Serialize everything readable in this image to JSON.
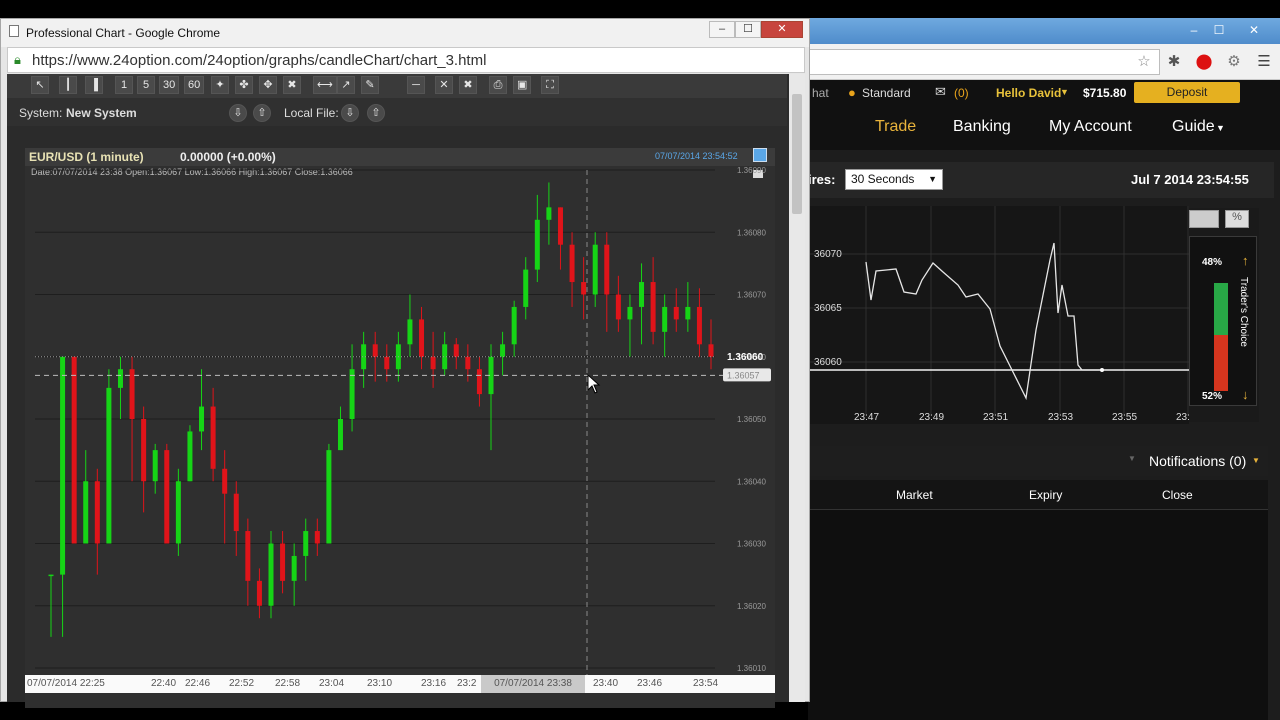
{
  "back_window": {
    "topbar": {
      "chat_partial": "hat",
      "account_type": "Standard",
      "messages": "(0)",
      "greeting": "Hello David",
      "balance": "$715.80",
      "deposit_label": "Deposit"
    },
    "nav": [
      "Trade",
      "Banking",
      "My Account",
      "Guide"
    ],
    "expires_label": "ires:",
    "expiry_select": "30 Seconds",
    "datetime": "Jul 7 2014  23:54:55",
    "mini_chart": {
      "y_ticks": [
        "36070",
        "36065",
        "36060"
      ],
      "x_ticks": [
        "23:47",
        "23:49",
        "23:51",
        "23:53",
        "23:55",
        "23:5"
      ],
      "points": [
        [
          866,
          262
        ],
        [
          871,
          300
        ],
        [
          876,
          271
        ],
        [
          896,
          269
        ],
        [
          904,
          292
        ],
        [
          916,
          294
        ],
        [
          922,
          280
        ],
        [
          933,
          263
        ],
        [
          943,
          272
        ],
        [
          958,
          285
        ],
        [
          966,
          297
        ],
        [
          978,
          294
        ],
        [
          990,
          309
        ],
        [
          1000,
          346
        ],
        [
          1012,
          370
        ],
        [
          1026,
          398
        ],
        [
          1036,
          330
        ],
        [
          1044,
          290
        ],
        [
          1050,
          260
        ],
        [
          1054,
          243
        ],
        [
          1058,
          313
        ],
        [
          1062,
          285
        ],
        [
          1068,
          316
        ],
        [
          1074,
          316
        ],
        [
          1078,
          365
        ],
        [
          1082,
          370
        ],
        [
          1102,
          370
        ]
      ]
    },
    "traders_choice": {
      "label": "Trader's Choice",
      "up_pct": "48%",
      "down_pct": "52%",
      "up": 0.48
    },
    "notifications": "Notifications (0)",
    "columns": [
      "Market",
      "Expiry",
      "Close"
    ]
  },
  "front_window": {
    "title": "Professional Chart - Google Chrome",
    "url": "https://www.24option.com/24option/graphs/candleChart/chart_3.html",
    "tools": [
      "1",
      "5",
      "30",
      "60"
    ],
    "system_label": "System:",
    "system_value": "New System",
    "local_file": "Local File:",
    "chart": {
      "pair": "EUR/USD (1 minute)",
      "change": "0.00000 (+0.00%)",
      "timestamp": "07/07/2014 23:54:52",
      "ohlc": "Date:07/07/2014 23:38 Open:1.36067 Low:1.36066 High:1.36067 Close:1.36066",
      "price_label": "1.36060",
      "cursor_price": "1.36057",
      "y_ticks": [
        "1.36090",
        "1.36080",
        "1.36070",
        "1.36060",
        "1.36050",
        "1.36040",
        "1.36030",
        "1.36020",
        "1.36010"
      ],
      "x_ticks": [
        "07/07/2014 22:25",
        "22:40",
        "22:46",
        "22:52",
        "22:58",
        "23:04",
        "23:10",
        "23:16",
        "23:2",
        "23:40",
        "23:46",
        "23:54"
      ],
      "crosshair_time": "07/07/2014 23:38"
    }
  },
  "chart_data": {
    "type": "candlestick",
    "ylim": [
      1.3601,
      1.3609
    ],
    "candles": [
      [
        1.36025,
        1.36025,
        1.36015,
        1.36025
      ],
      [
        1.36025,
        1.3606,
        1.36015,
        1.3606
      ],
      [
        1.3606,
        1.3603,
        1.3603,
        1.3606
      ],
      [
        1.3603,
        1.3604,
        1.3603,
        1.36045
      ],
      [
        1.3604,
        1.3603,
        1.36025,
        1.36042
      ],
      [
        1.3603,
        1.36055,
        1.3603,
        1.36058
      ],
      [
        1.36055,
        1.36058,
        1.3605,
        1.3606
      ],
      [
        1.36058,
        1.3605,
        1.3604,
        1.3606
      ],
      [
        1.3605,
        1.3604,
        1.36035,
        1.36052
      ],
      [
        1.3604,
        1.36045,
        1.36038,
        1.36046
      ],
      [
        1.36045,
        1.3603,
        1.3603,
        1.36046
      ],
      [
        1.3603,
        1.3604,
        1.36028,
        1.36042
      ],
      [
        1.3604,
        1.36048,
        1.3604,
        1.36049
      ],
      [
        1.36048,
        1.36052,
        1.36045,
        1.36058
      ],
      [
        1.36052,
        1.36042,
        1.3604,
        1.36055
      ],
      [
        1.36042,
        1.36038,
        1.3603,
        1.36045
      ],
      [
        1.36038,
        1.36032,
        1.36028,
        1.3604
      ],
      [
        1.36032,
        1.36024,
        1.3602,
        1.36034
      ],
      [
        1.36024,
        1.3602,
        1.36018,
        1.36026
      ],
      [
        1.3602,
        1.3603,
        1.36018,
        1.36032
      ],
      [
        1.3603,
        1.36024,
        1.36022,
        1.36032
      ],
      [
        1.36024,
        1.36028,
        1.3602,
        1.3603
      ],
      [
        1.36028,
        1.36032,
        1.36024,
        1.36034
      ],
      [
        1.36032,
        1.3603,
        1.36028,
        1.36034
      ],
      [
        1.3603,
        1.36045,
        1.3603,
        1.36046
      ],
      [
        1.36045,
        1.3605,
        1.36045,
        1.36052
      ],
      [
        1.3605,
        1.36058,
        1.36048,
        1.36062
      ],
      [
        1.36058,
        1.36062,
        1.36055,
        1.36064
      ],
      [
        1.36062,
        1.3606,
        1.36056,
        1.36064
      ],
      [
        1.3606,
        1.36058,
        1.36056,
        1.36062
      ],
      [
        1.36058,
        1.36062,
        1.36056,
        1.36064
      ],
      [
        1.36062,
        1.36066,
        1.3606,
        1.3607
      ],
      [
        1.36066,
        1.3606,
        1.36058,
        1.36068
      ],
      [
        1.3606,
        1.36058,
        1.36055,
        1.36064
      ],
      [
        1.36058,
        1.36062,
        1.36057,
        1.36064
      ],
      [
        1.36062,
        1.3606,
        1.36058,
        1.36063
      ],
      [
        1.3606,
        1.36058,
        1.36056,
        1.36062
      ],
      [
        1.36058,
        1.36054,
        1.36052,
        1.3606
      ],
      [
        1.36054,
        1.3606,
        1.36045,
        1.36062
      ],
      [
        1.3606,
        1.36062,
        1.36057,
        1.36064
      ],
      [
        1.36062,
        1.36068,
        1.3606,
        1.36069
      ],
      [
        1.36068,
        1.36074,
        1.36066,
        1.36076
      ],
      [
        1.36074,
        1.36082,
        1.36072,
        1.36086
      ],
      [
        1.36082,
        1.36084,
        1.36078,
        1.36088
      ],
      [
        1.36084,
        1.36078,
        1.36074,
        1.36084
      ],
      [
        1.36078,
        1.36072,
        1.36068,
        1.3608
      ],
      [
        1.36072,
        1.3607,
        1.36066,
        1.36076
      ],
      [
        1.3607,
        1.36078,
        1.36068,
        1.3608
      ],
      [
        1.36078,
        1.3607,
        1.36064,
        1.3608
      ],
      [
        1.3607,
        1.36066,
        1.36064,
        1.36073
      ],
      [
        1.36066,
        1.36068,
        1.3606,
        1.3607
      ],
      [
        1.36068,
        1.36072,
        1.36062,
        1.36075
      ],
      [
        1.36072,
        1.36064,
        1.36062,
        1.36076
      ],
      [
        1.36064,
        1.36068,
        1.3606,
        1.3607
      ],
      [
        1.36068,
        1.36066,
        1.36064,
        1.36071
      ],
      [
        1.36066,
        1.36068,
        1.36064,
        1.36072
      ],
      [
        1.36068,
        1.36062,
        1.3606,
        1.36071
      ],
      [
        1.36062,
        1.3606,
        1.36058,
        1.36066
      ]
    ]
  }
}
